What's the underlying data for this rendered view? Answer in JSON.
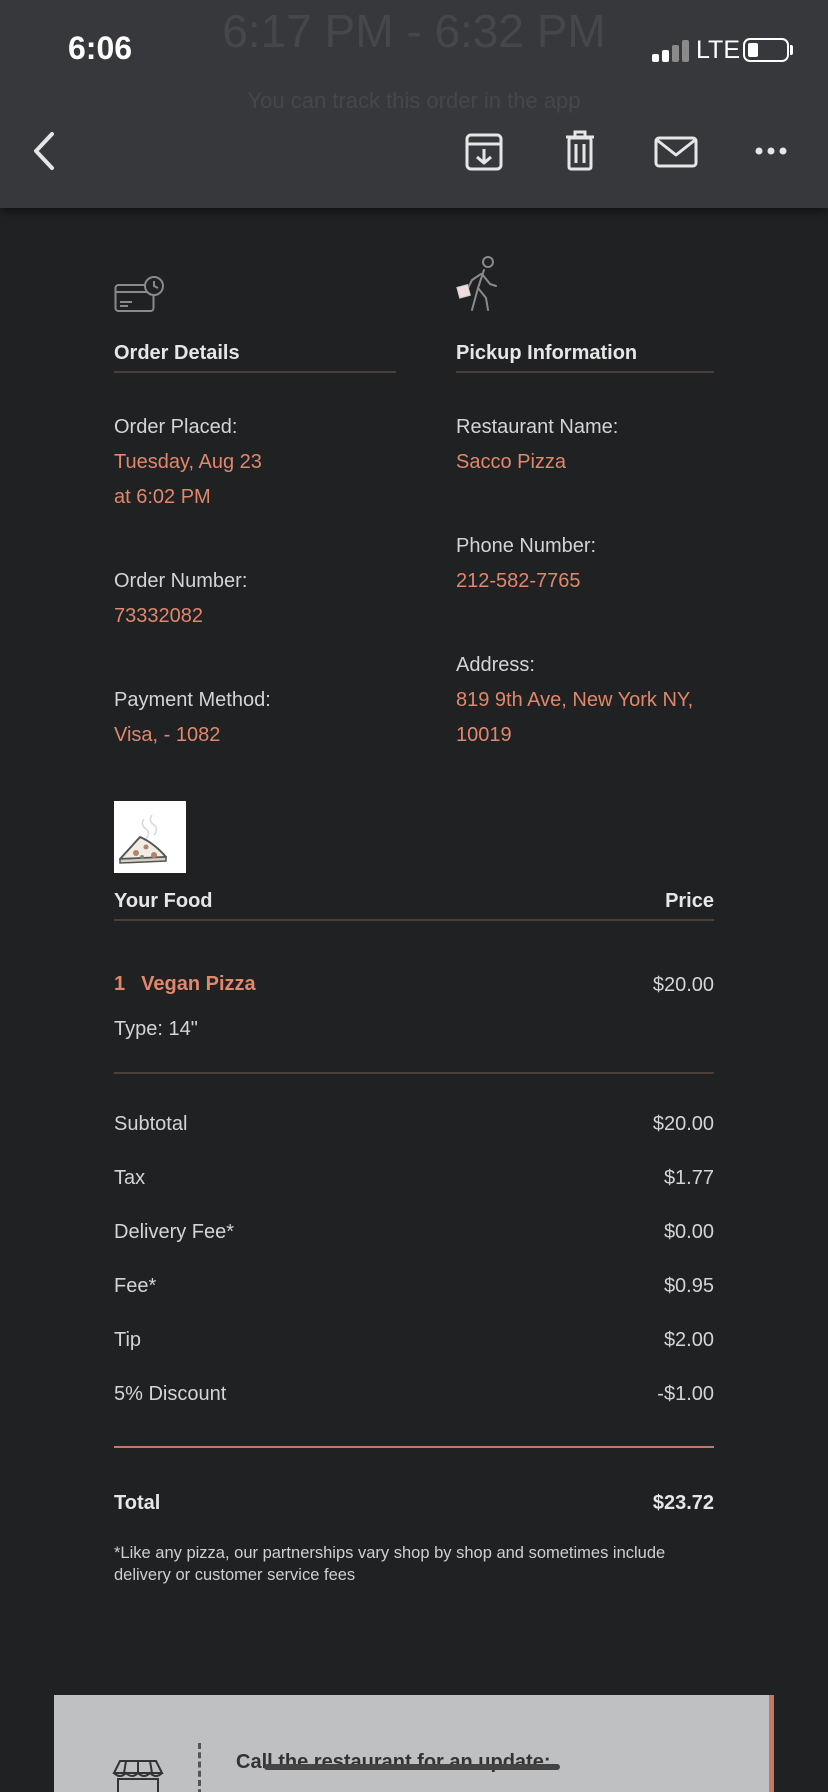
{
  "status_bar": {
    "time": "6:06",
    "network": "LTE"
  },
  "background_header": {
    "time_range": "6:17 PM - 6:32 PM",
    "subtitle": "You can track this order in the app"
  },
  "toolbar": {
    "icons": [
      "back-chevron-icon",
      "archive-icon",
      "trash-icon",
      "mail-icon",
      "more-icon"
    ]
  },
  "order_details": {
    "heading": "Order Details",
    "icon": "credit-card-clock-icon",
    "placed_label": "Order Placed:",
    "placed_value_line1": "Tuesday, Aug 23",
    "placed_value_line2": "at 6:02 PM",
    "number_label": "Order Number:",
    "number_value": "73332082",
    "payment_label": "Payment Method:",
    "payment_value": "Visa, - 1082"
  },
  "pickup": {
    "heading": "Pickup Information",
    "icon": "walking-person-icon",
    "restaurant_label": "Restaurant Name:",
    "restaurant_value": "Sacco Pizza",
    "phone_label": "Phone Number:",
    "phone_value": "212-582-7765",
    "address_label": "Address:",
    "address_line1": "819 9th Ave, New York NY,",
    "address_line2": "10019"
  },
  "food": {
    "heading": "Your Food",
    "price_heading": "Price",
    "thumbnail_icon": "pizza-slice-icon",
    "items": [
      {
        "qty": "1",
        "name": "Vegan Pizza",
        "price": "$20.00",
        "detail": "Type: 14\""
      }
    ]
  },
  "summary": {
    "rows": [
      {
        "label": "Subtotal",
        "value": "$20.00"
      },
      {
        "label": "Tax",
        "value": "$1.77"
      },
      {
        "label": "Delivery Fee*",
        "value": "$0.00"
      },
      {
        "label": "Fee*",
        "value": "$0.95"
      },
      {
        "label": "Tip",
        "value": "$2.00"
      },
      {
        "label": "5% Discount",
        "value": "-$1.00"
      }
    ],
    "total_label": "Total",
    "total_value": "$23.72",
    "footnote": "*Like any pizza, our partnerships vary shop by shop and sometimes include delivery or customer service fees"
  },
  "bottom_card": {
    "icon": "storefront-icon",
    "text": "Call the restaurant for an update:"
  },
  "colors": {
    "accent": "#e0876c",
    "background": "#202123",
    "toolbar": "#37383b"
  }
}
